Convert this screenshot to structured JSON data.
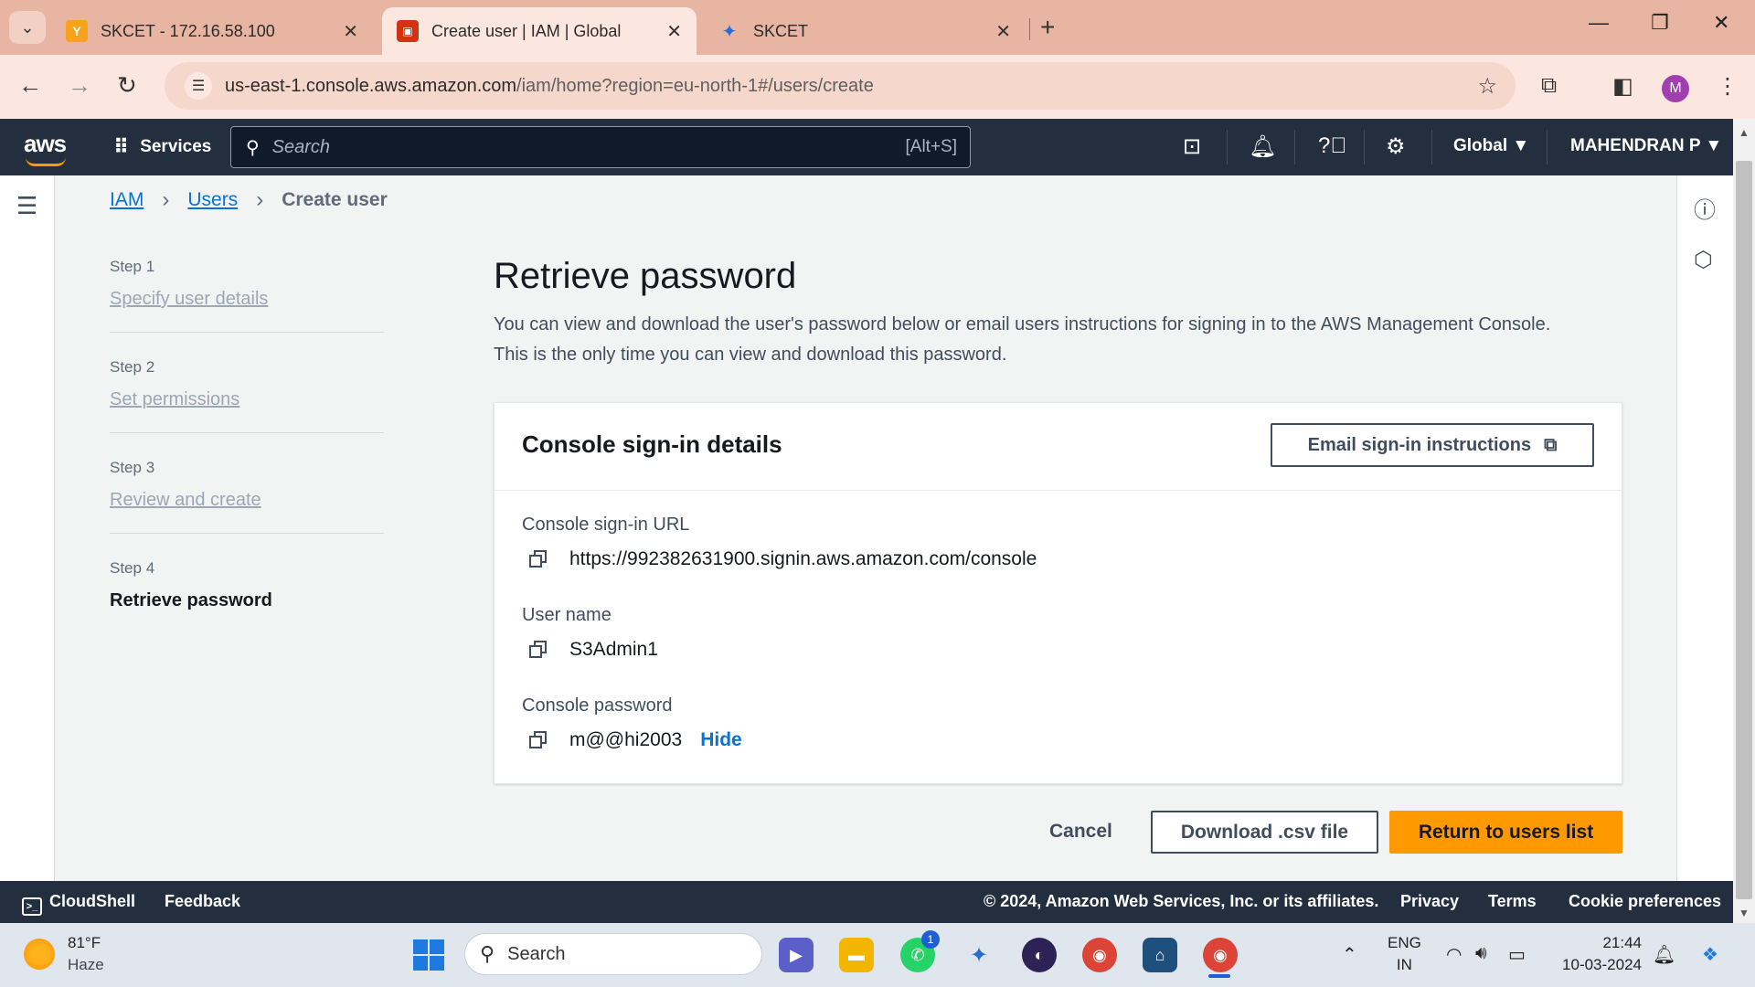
{
  "browser": {
    "tabs": [
      {
        "title": "SKCET - 172.16.58.100"
      },
      {
        "title": "Create user | IAM | Global"
      },
      {
        "title": "SKCET"
      }
    ],
    "url_host": "us-east-1.console.aws.amazon.com",
    "url_path": "/iam/home?region=eu-north-1#/users/create",
    "profile_initial": "M"
  },
  "aws_nav": {
    "logo": "aws",
    "services_label": "Services",
    "search_placeholder": "Search",
    "search_shortcut": "[Alt+S]",
    "region": "Global ▼",
    "account": "MAHENDRAN P ▼"
  },
  "breadcrumb": {
    "iam": "IAM",
    "users": "Users",
    "current": "Create user"
  },
  "steps": [
    {
      "num": "Step 1",
      "label": "Specify user details"
    },
    {
      "num": "Step 2",
      "label": "Set permissions"
    },
    {
      "num": "Step 3",
      "label": "Review and create"
    },
    {
      "num": "Step 4",
      "label": "Retrieve password"
    }
  ],
  "main": {
    "title": "Retrieve password",
    "desc_line1": "You can view and download the user's password below or email users instructions for signing in to the AWS Management Console.",
    "desc_line2": "This is the only time you can view and download this password."
  },
  "panel": {
    "title": "Console sign-in details",
    "email_button": "Email sign-in instructions",
    "url_label": "Console sign-in URL",
    "url_value": "https://992382631900.signin.aws.amazon.com/console",
    "user_label": "User name",
    "user_value": "S3Admin1",
    "password_label": "Console password",
    "password_value": "m@@hi2003",
    "hide_label": "Hide"
  },
  "actions": {
    "cancel": "Cancel",
    "download": "Download .csv file",
    "return": "Return to users list"
  },
  "footer": {
    "cloudshell": "CloudShell",
    "feedback": "Feedback",
    "copyright": "© 2024, Amazon Web Services, Inc. or its affiliates.",
    "privacy": "Privacy",
    "terms": "Terms",
    "cookies": "Cookie preferences"
  },
  "taskbar": {
    "temp": "81°F",
    "weather": "Haze",
    "search": "Search",
    "whatsapp_badge": "1",
    "lang1": "ENG",
    "lang2": "IN",
    "time": "21:44",
    "date": "10-03-2024"
  },
  "colors": {
    "aws_nav": "#232f3e",
    "link": "#0972d3",
    "primary_button": "#ff9900"
  }
}
